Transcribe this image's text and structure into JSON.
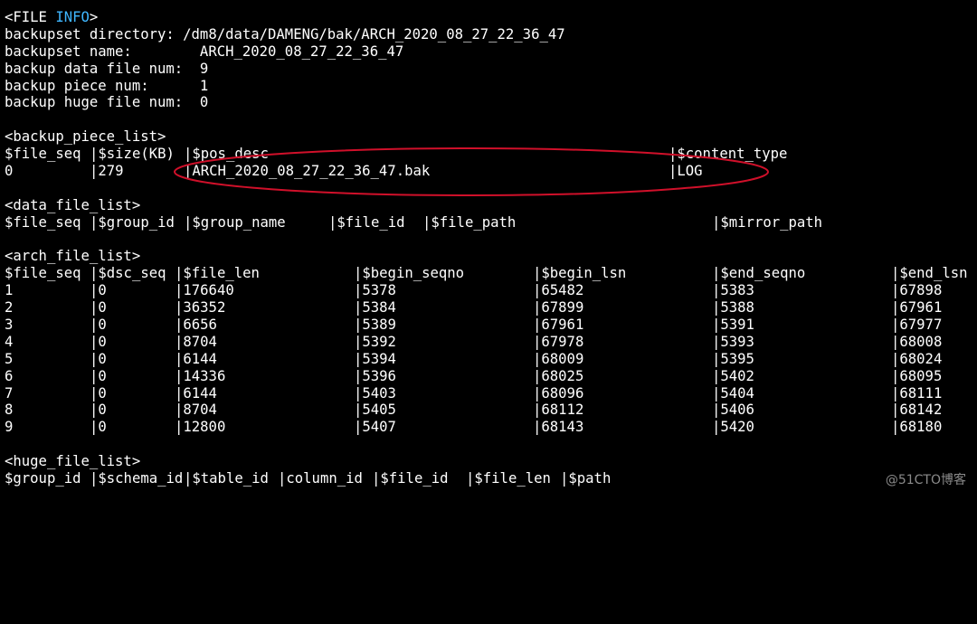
{
  "file_info": {
    "open_tag_prefix": "<FILE ",
    "open_tag_keyword": "INFO",
    "open_tag_suffix": ">",
    "rows": [
      "backupset directory: /dm8/data/DAMENG/bak/ARCH_2020_08_27_22_36_47",
      "backupset name:        ARCH_2020_08_27_22_36_47",
      "backup data file num:  9",
      "backup piece num:      1",
      "backup huge file num:  0"
    ]
  },
  "backup_piece_list": {
    "tag": "<backup_piece_list>",
    "headers": [
      "$file_seq",
      "|$size(KB)",
      "|$pos_desc",
      "|$content_type"
    ],
    "rows": [
      [
        "0",
        "|279",
        "|ARCH_2020_08_27_22_36_47.bak",
        "|LOG"
      ]
    ]
  },
  "data_file_list": {
    "tag": "<data_file_list>",
    "headers": [
      "$file_seq",
      "|$group_id",
      "|$group_name",
      "|$file_id",
      "|$file_path",
      "|$mirror_path"
    ]
  },
  "arch_file_list": {
    "tag": "<arch_file_list>",
    "headers": [
      "$file_seq",
      "|$dsc_seq",
      "|$file_len",
      "|$begin_seqno",
      "|$begin_lsn",
      "|$end_seqno",
      "|$end_lsn"
    ],
    "rows": [
      [
        "1",
        "|0",
        "|176640",
        "|5378",
        "|65482",
        "|5383",
        "|67898"
      ],
      [
        "2",
        "|0",
        "|36352",
        "|5384",
        "|67899",
        "|5388",
        "|67961"
      ],
      [
        "3",
        "|0",
        "|6656",
        "|5389",
        "|67961",
        "|5391",
        "|67977"
      ],
      [
        "4",
        "|0",
        "|8704",
        "|5392",
        "|67978",
        "|5393",
        "|68008"
      ],
      [
        "5",
        "|0",
        "|6144",
        "|5394",
        "|68009",
        "|5395",
        "|68024"
      ],
      [
        "6",
        "|0",
        "|14336",
        "|5396",
        "|68025",
        "|5402",
        "|68095"
      ],
      [
        "7",
        "|0",
        "|6144",
        "|5403",
        "|68096",
        "|5404",
        "|68111"
      ],
      [
        "8",
        "|0",
        "|8704",
        "|5405",
        "|68112",
        "|5406",
        "|68142"
      ],
      [
        "9",
        "|0",
        "|12800",
        "|5407",
        "|68143",
        "|5420",
        "|68180"
      ]
    ]
  },
  "huge_file_list": {
    "tag": "<huge_file_list>",
    "headers": [
      "$group_id",
      "|$schema_id",
      "|$table_id",
      "|column_id",
      "|$file_id",
      "|$file_len",
      "|$path"
    ]
  },
  "colors": {
    "background": "#000000",
    "text": "#ffffff",
    "keyword": "#3fb6ff",
    "annotation": "#d0102a",
    "watermark": "#8a8a8a"
  },
  "watermark": "@51CTO博客"
}
